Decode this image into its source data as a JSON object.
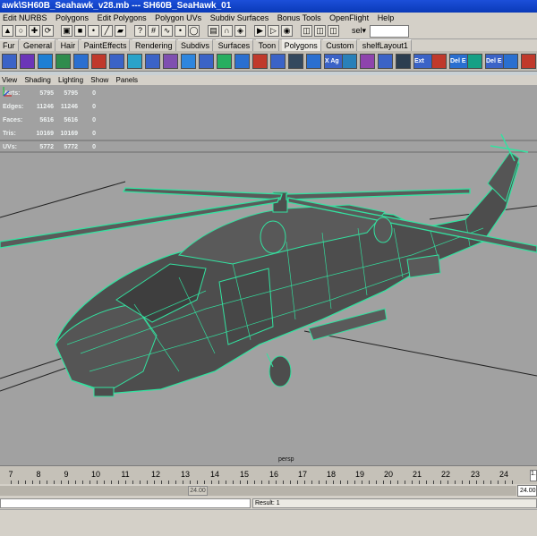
{
  "titlebar": {
    "text": "awk\\SH60B_Seahawk_v28.mb  ---  SH60B_SeaHawk_01"
  },
  "menubar": {
    "items": [
      "Edit NURBS",
      "Polygons",
      "Edit Polygons",
      "Polygon UVs",
      "Subdiv Surfaces",
      "Bonus Tools",
      "OpenFlight",
      "Help"
    ]
  },
  "statusline": {
    "sel_label": "sel▾",
    "sel_value": ""
  },
  "shelf_tabs": {
    "items": [
      "Fur",
      "General",
      "Hair",
      "PaintEffects",
      "Rendering",
      "Subdivs",
      "Surfaces",
      "Toon",
      "Polygons",
      "Custom",
      "shelfLayout1"
    ],
    "active": "Polygons"
  },
  "shelf_labels": {
    "a": "X Ag",
    "b": "Ext",
    "c": "Del E",
    "d": "Del E"
  },
  "panel_menu": {
    "items": [
      "View",
      "Shading",
      "Lighting",
      "Show",
      "Panels"
    ]
  },
  "hud": {
    "rows": [
      {
        "label": "Verts:",
        "v1": "5795",
        "v2": "5795",
        "v3": "0"
      },
      {
        "label": "Edges:",
        "v1": "11246",
        "v2": "11246",
        "v3": "0"
      },
      {
        "label": "Faces:",
        "v1": "5616",
        "v2": "5616",
        "v3": "0"
      },
      {
        "label": "Tris:",
        "v1": "10169",
        "v2": "10169",
        "v3": "0"
      },
      {
        "label": "UVs:",
        "v1": "5772",
        "v2": "5772",
        "v3": "0"
      }
    ]
  },
  "viewport": {
    "camera": "persp",
    "wire_color": "#33e2a0",
    "mesh_color": "#4d4d4d",
    "background": "#a1a1a1"
  },
  "timeslider": {
    "ticks": [
      "7",
      "8",
      "9",
      "10",
      "11",
      "12",
      "13",
      "14",
      "15",
      "16",
      "17",
      "18",
      "19",
      "20",
      "21",
      "22",
      "23",
      "24"
    ],
    "current_frame": "1.0"
  },
  "rangeslider": {
    "handle_label": "24.00",
    "end_value": "24.00"
  },
  "cmdline": {
    "result": "Result: 1"
  }
}
